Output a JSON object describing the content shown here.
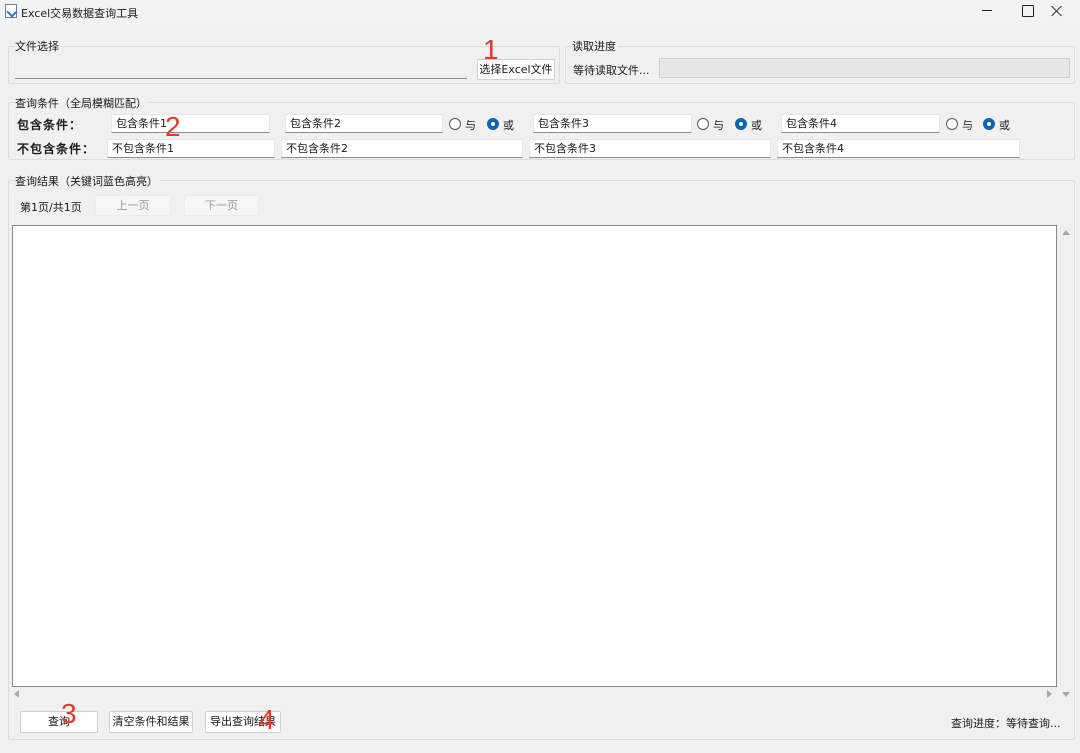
{
  "window": {
    "title": "Excel交易数据查询工具"
  },
  "file_select": {
    "group_label": "文件选择",
    "file_path_value": "",
    "select_button_label": "选择Excel文件"
  },
  "read_progress": {
    "group_label": "读取进度",
    "status_text": "等待读取文件...",
    "progress_fraction": 0
  },
  "query_conditions": {
    "group_label": "查询条件（全局模糊匹配）",
    "include_label": "包含条件：",
    "exclude_label": "不包含条件：",
    "include_fields": [
      "包含条件1",
      "包含条件2",
      "包含条件3",
      "包含条件4"
    ],
    "exclude_fields": [
      "不包含条件1",
      "不包含条件2",
      "不包含条件3",
      "不包含条件4"
    ],
    "logic_options": [
      {
        "and_label": "与",
        "or_label": "或",
        "selected": "或"
      },
      {
        "and_label": "与",
        "or_label": "或",
        "selected": "或"
      },
      {
        "and_label": "与",
        "or_label": "或",
        "selected": "或"
      }
    ]
  },
  "results": {
    "group_label": "查询结果（关键词蓝色高亮）",
    "page_info": "第1页/共1页",
    "prev_page_label": "上一页",
    "next_page_label": "下一页"
  },
  "bottom_bar": {
    "query_button_label": "查询",
    "clear_button_label": "清空条件和结果",
    "export_button_label": "导出查询结果",
    "status_text": "查询进度：等待查询..."
  },
  "annotations": [
    "1",
    "2",
    "3",
    "4"
  ],
  "colors": {
    "window_bg": "#f0f0f0",
    "radio_selected": "#0c64b5",
    "annotation_red": "#e03a2f"
  }
}
